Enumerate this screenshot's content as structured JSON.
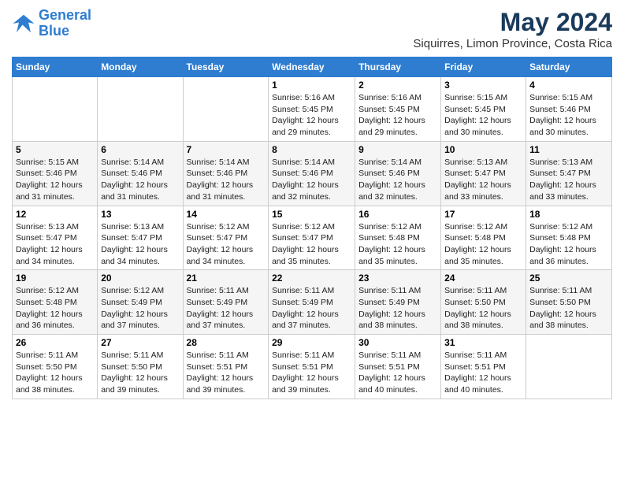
{
  "logo": {
    "line1": "General",
    "line2": "Blue"
  },
  "title": {
    "month_year": "May 2024",
    "location": "Siquirres, Limon Province, Costa Rica"
  },
  "days_of_week": [
    "Sunday",
    "Monday",
    "Tuesday",
    "Wednesday",
    "Thursday",
    "Friday",
    "Saturday"
  ],
  "weeks": [
    [
      {
        "day": "",
        "info": ""
      },
      {
        "day": "",
        "info": ""
      },
      {
        "day": "",
        "info": ""
      },
      {
        "day": "1",
        "info": "Sunrise: 5:16 AM\nSunset: 5:45 PM\nDaylight: 12 hours\nand 29 minutes."
      },
      {
        "day": "2",
        "info": "Sunrise: 5:16 AM\nSunset: 5:45 PM\nDaylight: 12 hours\nand 29 minutes."
      },
      {
        "day": "3",
        "info": "Sunrise: 5:15 AM\nSunset: 5:45 PM\nDaylight: 12 hours\nand 30 minutes."
      },
      {
        "day": "4",
        "info": "Sunrise: 5:15 AM\nSunset: 5:46 PM\nDaylight: 12 hours\nand 30 minutes."
      }
    ],
    [
      {
        "day": "5",
        "info": "Sunrise: 5:15 AM\nSunset: 5:46 PM\nDaylight: 12 hours\nand 31 minutes."
      },
      {
        "day": "6",
        "info": "Sunrise: 5:14 AM\nSunset: 5:46 PM\nDaylight: 12 hours\nand 31 minutes."
      },
      {
        "day": "7",
        "info": "Sunrise: 5:14 AM\nSunset: 5:46 PM\nDaylight: 12 hours\nand 31 minutes."
      },
      {
        "day": "8",
        "info": "Sunrise: 5:14 AM\nSunset: 5:46 PM\nDaylight: 12 hours\nand 32 minutes."
      },
      {
        "day": "9",
        "info": "Sunrise: 5:14 AM\nSunset: 5:46 PM\nDaylight: 12 hours\nand 32 minutes."
      },
      {
        "day": "10",
        "info": "Sunrise: 5:13 AM\nSunset: 5:47 PM\nDaylight: 12 hours\nand 33 minutes."
      },
      {
        "day": "11",
        "info": "Sunrise: 5:13 AM\nSunset: 5:47 PM\nDaylight: 12 hours\nand 33 minutes."
      }
    ],
    [
      {
        "day": "12",
        "info": "Sunrise: 5:13 AM\nSunset: 5:47 PM\nDaylight: 12 hours\nand 34 minutes."
      },
      {
        "day": "13",
        "info": "Sunrise: 5:13 AM\nSunset: 5:47 PM\nDaylight: 12 hours\nand 34 minutes."
      },
      {
        "day": "14",
        "info": "Sunrise: 5:12 AM\nSunset: 5:47 PM\nDaylight: 12 hours\nand 34 minutes."
      },
      {
        "day": "15",
        "info": "Sunrise: 5:12 AM\nSunset: 5:47 PM\nDaylight: 12 hours\nand 35 minutes."
      },
      {
        "day": "16",
        "info": "Sunrise: 5:12 AM\nSunset: 5:48 PM\nDaylight: 12 hours\nand 35 minutes."
      },
      {
        "day": "17",
        "info": "Sunrise: 5:12 AM\nSunset: 5:48 PM\nDaylight: 12 hours\nand 35 minutes."
      },
      {
        "day": "18",
        "info": "Sunrise: 5:12 AM\nSunset: 5:48 PM\nDaylight: 12 hours\nand 36 minutes."
      }
    ],
    [
      {
        "day": "19",
        "info": "Sunrise: 5:12 AM\nSunset: 5:48 PM\nDaylight: 12 hours\nand 36 minutes."
      },
      {
        "day": "20",
        "info": "Sunrise: 5:12 AM\nSunset: 5:49 PM\nDaylight: 12 hours\nand 37 minutes."
      },
      {
        "day": "21",
        "info": "Sunrise: 5:11 AM\nSunset: 5:49 PM\nDaylight: 12 hours\nand 37 minutes."
      },
      {
        "day": "22",
        "info": "Sunrise: 5:11 AM\nSunset: 5:49 PM\nDaylight: 12 hours\nand 37 minutes."
      },
      {
        "day": "23",
        "info": "Sunrise: 5:11 AM\nSunset: 5:49 PM\nDaylight: 12 hours\nand 38 minutes."
      },
      {
        "day": "24",
        "info": "Sunrise: 5:11 AM\nSunset: 5:50 PM\nDaylight: 12 hours\nand 38 minutes."
      },
      {
        "day": "25",
        "info": "Sunrise: 5:11 AM\nSunset: 5:50 PM\nDaylight: 12 hours\nand 38 minutes."
      }
    ],
    [
      {
        "day": "26",
        "info": "Sunrise: 5:11 AM\nSunset: 5:50 PM\nDaylight: 12 hours\nand 38 minutes."
      },
      {
        "day": "27",
        "info": "Sunrise: 5:11 AM\nSunset: 5:50 PM\nDaylight: 12 hours\nand 39 minutes."
      },
      {
        "day": "28",
        "info": "Sunrise: 5:11 AM\nSunset: 5:51 PM\nDaylight: 12 hours\nand 39 minutes."
      },
      {
        "day": "29",
        "info": "Sunrise: 5:11 AM\nSunset: 5:51 PM\nDaylight: 12 hours\nand 39 minutes."
      },
      {
        "day": "30",
        "info": "Sunrise: 5:11 AM\nSunset: 5:51 PM\nDaylight: 12 hours\nand 40 minutes."
      },
      {
        "day": "31",
        "info": "Sunrise: 5:11 AM\nSunset: 5:51 PM\nDaylight: 12 hours\nand 40 minutes."
      },
      {
        "day": "",
        "info": ""
      }
    ]
  ]
}
